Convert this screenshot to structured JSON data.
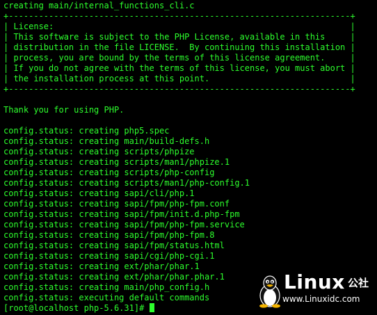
{
  "terminal": {
    "lines": [
      "creating main/internal_functions_cli.c",
      "+--------------------------------------------------------------------+",
      "| License:                                                           |",
      "| This software is subject to the PHP License, available in this     |",
      "| distribution in the file LICENSE.  By continuing this installation |",
      "| process, you are bound by the terms of this license agreement.     |",
      "| If you do not agree with the terms of this license, you must abort |",
      "| the installation process at this point.                            |",
      "+--------------------------------------------------------------------+",
      "",
      "Thank you for using PHP.",
      "",
      "config.status: creating php5.spec",
      "config.status: creating main/build-defs.h",
      "config.status: creating scripts/phpize",
      "config.status: creating scripts/man1/phpize.1",
      "config.status: creating scripts/php-config",
      "config.status: creating scripts/man1/php-config.1",
      "config.status: creating sapi/cli/php.1",
      "config.status: creating sapi/fpm/php-fpm.conf",
      "config.status: creating sapi/fpm/init.d.php-fpm",
      "config.status: creating sapi/fpm/php-fpm.service",
      "config.status: creating sapi/fpm/php-fpm.8",
      "config.status: creating sapi/fpm/status.html",
      "config.status: creating sapi/cgi/php-cgi.1",
      "config.status: creating ext/phar/phar.1",
      "config.status: creating ext/phar/phar.phar.1",
      "config.status: creating main/php_config.h",
      "config.status: executing default commands"
    ],
    "prompt": "[root@localhost php-5.6.31]# ",
    "text_color": "#2dff2d",
    "background_color": "#000000"
  },
  "watermark": {
    "title": "Linux",
    "cn": "公社",
    "url": "www.Linuxidc.com",
    "icon": "tux-penguin-icon"
  }
}
